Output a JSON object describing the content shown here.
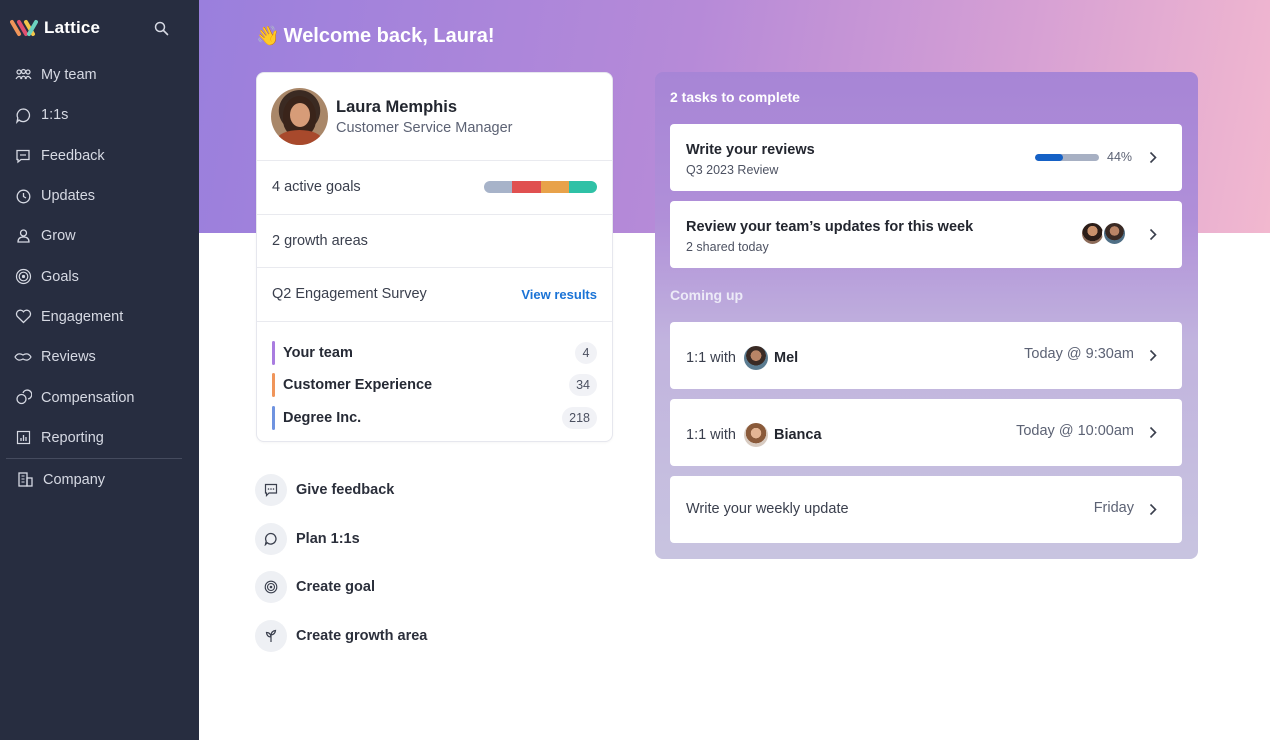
{
  "app": {
    "name": "Lattice"
  },
  "colors": {
    "sidebar": "#272d40",
    "accent": "#1a73d6",
    "progress": "#1561c6",
    "goal_segments": [
      "#a7b3c9",
      "#e05050",
      "#e8a24a",
      "#2fc1a6"
    ],
    "group_bars": [
      "#a97ce0",
      "#f0955a",
      "#6f93e0"
    ]
  },
  "sidebar": {
    "items": [
      {
        "label": "My team",
        "icon": "team-icon"
      },
      {
        "label": "1:1s",
        "icon": "chat-bubble-icon"
      },
      {
        "label": "Feedback",
        "icon": "message-icon"
      },
      {
        "label": "Updates",
        "icon": "updates-icon"
      },
      {
        "label": "Grow",
        "icon": "grow-icon"
      },
      {
        "label": "Goals",
        "icon": "target-icon"
      },
      {
        "label": "Engagement",
        "icon": "heart-icon"
      },
      {
        "label": "Reviews",
        "icon": "reviews-icon"
      },
      {
        "label": "Compensation",
        "icon": "compensation-icon"
      },
      {
        "label": "Reporting",
        "icon": "chart-icon"
      }
    ],
    "company": {
      "label": "Company",
      "icon": "building-icon"
    }
  },
  "welcome": {
    "emoji": "👋",
    "text": "Welcome back, Laura!"
  },
  "profile": {
    "name": "Laura Memphis",
    "role": "Customer Service Manager",
    "goals_label": "4 active goals",
    "growth_label": "2 growth areas",
    "survey_label": "Q2 Engagement Survey",
    "survey_link": "View results",
    "groups": [
      {
        "name": "Your team",
        "count": "4"
      },
      {
        "name": "Customer Experience",
        "count": "34"
      },
      {
        "name": "Degree Inc.",
        "count": "218"
      }
    ]
  },
  "quick_actions": [
    {
      "label": "Give feedback",
      "icon": "feedback-icon"
    },
    {
      "label": "Plan 1:1s",
      "icon": "chat-bubble-icon"
    },
    {
      "label": "Create goal",
      "icon": "target-icon"
    },
    {
      "label": "Create growth area",
      "icon": "growth-icon"
    }
  ],
  "tasks": {
    "title": "2 tasks to complete",
    "items": [
      {
        "title": "Write your reviews",
        "subtitle": "Q3 2023 Review",
        "progress": 0.44,
        "progress_label": "44%"
      },
      {
        "title": "Review your team’s updates for this week",
        "subtitle": "2 shared today"
      }
    ],
    "coming_title": "Coming up",
    "upcoming": [
      {
        "prefix": "1:1 with",
        "who": "Mel",
        "when": "Today @ 9:30am"
      },
      {
        "prefix": "1:1 with",
        "who": "Bianca",
        "when": "Today @ 10:00am"
      },
      {
        "text": "Write your weekly update",
        "when": "Friday"
      }
    ]
  }
}
